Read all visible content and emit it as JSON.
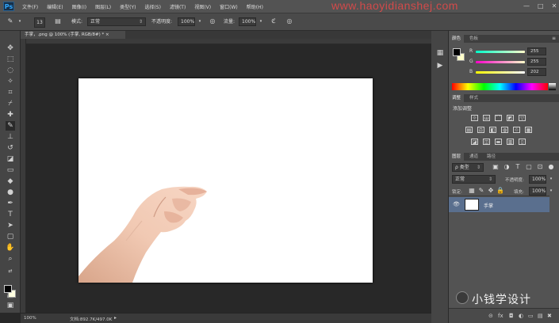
{
  "app": {
    "logo": "Ps",
    "menu": [
      "文件(F)",
      "编辑(E)",
      "图像(I)",
      "图层(L)",
      "类型(Y)",
      "选择(S)",
      "滤镜(T)",
      "视图(V)",
      "窗口(W)",
      "帮助(H)"
    ],
    "watermark_url": "www.haoyidianshej.com",
    "window_controls": [
      "—",
      "□",
      "✕"
    ]
  },
  "options": {
    "brush_size": "13",
    "mode_label": "模式:",
    "mode_value": "正常",
    "opacity_label": "不透明度:",
    "opacity_value": "100%",
    "flow_label": "流量:",
    "flow_value": "100%"
  },
  "document": {
    "tab_title": "手掌，.png @ 100% (手掌, RGB/8#) * ×",
    "zoom": "100%",
    "doc_info": "文档:892.7K/497.0K"
  },
  "color_panel": {
    "tabs": [
      "颜色",
      "色板"
    ],
    "channels": [
      {
        "label": "R",
        "value": "255"
      },
      {
        "label": "G",
        "value": "255"
      },
      {
        "label": "B",
        "value": "202"
      }
    ],
    "foreground": "#000000",
    "background": "#ffffca"
  },
  "adjust_panel": {
    "tabs": [
      "调整",
      "样式"
    ],
    "title": "添加调整"
  },
  "layers_panel": {
    "tabs": [
      "图层",
      "通道",
      "路径"
    ],
    "filter_label": "ρ 类型",
    "blend_mode": "正常",
    "opacity_label": "不透明度:",
    "opacity_value": "100%",
    "lock_label": "锁定:",
    "fill_label": "填充:",
    "fill_value": "100%",
    "layers": [
      {
        "name": "手掌"
      }
    ]
  },
  "watermark": {
    "brand_text": "小钱学设计"
  }
}
